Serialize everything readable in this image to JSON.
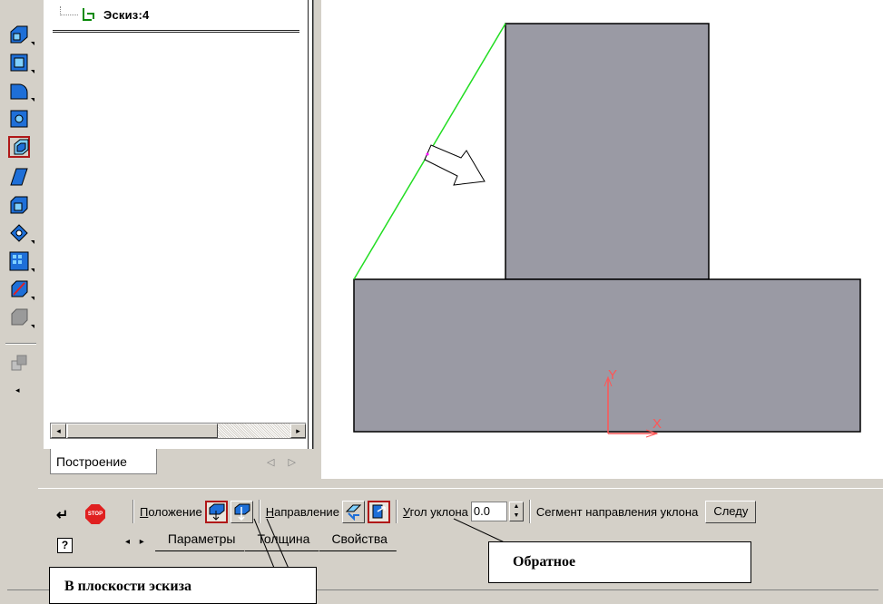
{
  "tree": {
    "sketch_label": "Эскиз:4"
  },
  "panel_tab": {
    "label": "Построение",
    "arrows": "◁ ▷"
  },
  "toolbar": {
    "more_label": "◂"
  },
  "properties": {
    "position_label_u": "П",
    "position_label_rest": "оложение",
    "direction_label_u": "Н",
    "direction_label_rest": "аправление",
    "angle_label_u": "У",
    "angle_label_rest": "гол уклона",
    "angle_value": "0.0",
    "segment_label": "Сегмент направления уклона",
    "next_label": "Следу",
    "tabs": [
      "Параметры",
      "Толщина",
      "Свойства"
    ],
    "tab_nav": "◂ ▸"
  },
  "icons": {
    "enter": "↵",
    "stop": "STOP",
    "help": "?"
  },
  "axes": {
    "x": "X",
    "y": "Y"
  },
  "callouts": {
    "in_sketch_plane": "В плоскости эскиза",
    "reverse": "Обратное"
  },
  "colors": {
    "part_fill": "#9a9aa4",
    "slope_line": "#22dd22",
    "axis_color": "#ff5555",
    "active_border": "#b01818"
  }
}
